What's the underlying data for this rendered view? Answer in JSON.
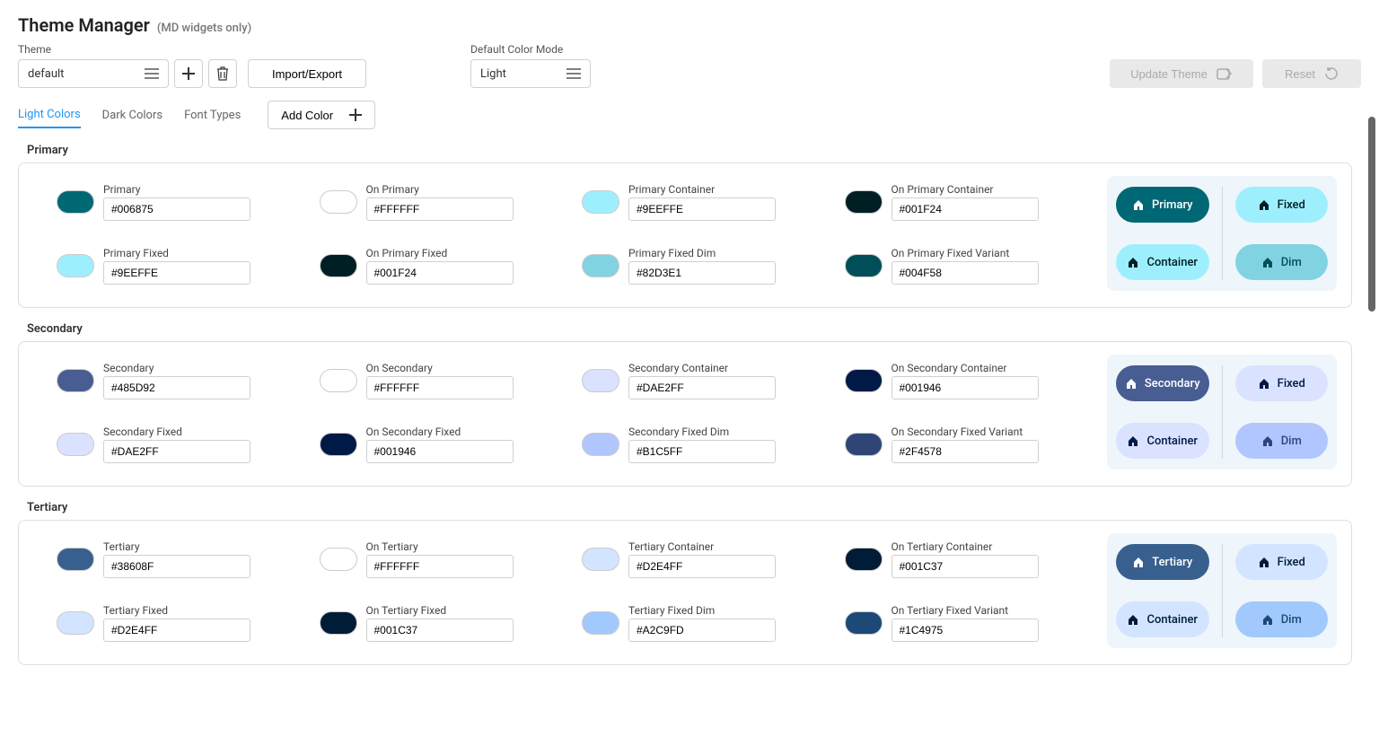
{
  "header": {
    "title": "Theme Manager",
    "subtitle": "(MD widgets only)"
  },
  "controls": {
    "theme_label": "Theme",
    "theme_value": "default",
    "import_export": "Import/Export",
    "mode_label": "Default Color Mode",
    "mode_value": "Light",
    "update_theme": "Update Theme",
    "reset": "Reset"
  },
  "tabs": {
    "light_colors": "Light Colors",
    "dark_colors": "Dark Colors",
    "font_types": "Font Types",
    "add_color": "Add Color"
  },
  "sections": [
    {
      "name": "Primary",
      "colors": [
        {
          "label": "Primary",
          "value": "#006875",
          "swatch": "#006875"
        },
        {
          "label": "On Primary",
          "value": "#FFFFFF",
          "swatch": "#FFFFFF"
        },
        {
          "label": "Primary Container",
          "value": "#9EEFFE",
          "swatch": "#9EEFFE"
        },
        {
          "label": "On Primary Container",
          "value": "#001F24",
          "swatch": "#001F24"
        },
        {
          "label": "Primary Fixed",
          "value": "#9EEFFE",
          "swatch": "#9EEFFE"
        },
        {
          "label": "On Primary Fixed",
          "value": "#001F24",
          "swatch": "#001F24"
        },
        {
          "label": "Primary Fixed Dim",
          "value": "#82D3E1",
          "swatch": "#82D3E1"
        },
        {
          "label": "On Primary Fixed Variant",
          "value": "#004F58",
          "swatch": "#004F58"
        }
      ],
      "preview": [
        {
          "label": "Primary",
          "bg": "#006875",
          "fg": "#FFFFFF"
        },
        {
          "label": "Fixed",
          "bg": "#9EEFFE",
          "fg": "#001F24"
        },
        {
          "label": "Container",
          "bg": "#9EEFFE",
          "fg": "#001F24"
        },
        {
          "label": "Dim",
          "bg": "#82D3E1",
          "fg": "#004F58"
        }
      ]
    },
    {
      "name": "Secondary",
      "colors": [
        {
          "label": "Secondary",
          "value": "#485D92",
          "swatch": "#485D92"
        },
        {
          "label": "On Secondary",
          "value": "#FFFFFF",
          "swatch": "#FFFFFF"
        },
        {
          "label": "Secondary Container",
          "value": "#DAE2FF",
          "swatch": "#DAE2FF"
        },
        {
          "label": "On Secondary Container",
          "value": "#001946",
          "swatch": "#001946"
        },
        {
          "label": "Secondary Fixed",
          "value": "#DAE2FF",
          "swatch": "#DAE2FF"
        },
        {
          "label": "On Secondary Fixed",
          "value": "#001946",
          "swatch": "#001946"
        },
        {
          "label": "Secondary Fixed Dim",
          "value": "#B1C5FF",
          "swatch": "#B1C5FF"
        },
        {
          "label": "On Secondary Fixed Variant",
          "value": "#2F4578",
          "swatch": "#2F4578"
        }
      ],
      "preview": [
        {
          "label": "Secondary",
          "bg": "#485D92",
          "fg": "#FFFFFF"
        },
        {
          "label": "Fixed",
          "bg": "#DAE2FF",
          "fg": "#001946"
        },
        {
          "label": "Container",
          "bg": "#DAE2FF",
          "fg": "#001946"
        },
        {
          "label": "Dim",
          "bg": "#B1C5FF",
          "fg": "#2F4578"
        }
      ]
    },
    {
      "name": "Tertiary",
      "colors": [
        {
          "label": "Tertiary",
          "value": "#38608F",
          "swatch": "#38608F"
        },
        {
          "label": "On Tertiary",
          "value": "#FFFFFF",
          "swatch": "#FFFFFF"
        },
        {
          "label": "Tertiary Container",
          "value": "#D2E4FF",
          "swatch": "#D2E4FF"
        },
        {
          "label": "On Tertiary Container",
          "value": "#001C37",
          "swatch": "#001C37"
        },
        {
          "label": "Tertiary Fixed",
          "value": "#D2E4FF",
          "swatch": "#D2E4FF"
        },
        {
          "label": "On Tertiary Fixed",
          "value": "#001C37",
          "swatch": "#001C37"
        },
        {
          "label": "Tertiary Fixed Dim",
          "value": "#A2C9FD",
          "swatch": "#A2C9FD"
        },
        {
          "label": "On Tertiary Fixed Variant",
          "value": "#1C4975",
          "swatch": "#1C4975"
        }
      ],
      "preview": [
        {
          "label": "Tertiary",
          "bg": "#38608F",
          "fg": "#FFFFFF"
        },
        {
          "label": "Fixed",
          "bg": "#D2E4FF",
          "fg": "#001C37"
        },
        {
          "label": "Container",
          "bg": "#D2E4FF",
          "fg": "#001C37"
        },
        {
          "label": "Dim",
          "bg": "#A2C9FD",
          "fg": "#1C4975"
        }
      ]
    }
  ]
}
